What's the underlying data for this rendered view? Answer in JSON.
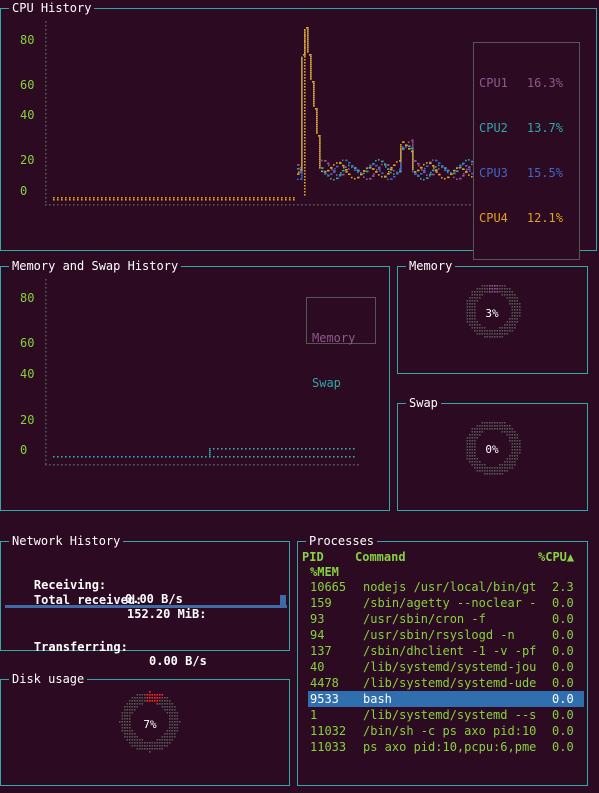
{
  "cpu": {
    "title": "CPU History",
    "yticks": [
      "80",
      "60",
      "40",
      "20",
      "0"
    ],
    "legend": [
      {
        "name": "CPU1",
        "value": "16.3%",
        "color": "#8e5a8e"
      },
      {
        "name": "CPU2",
        "value": "13.7%",
        "color": "#2ea8a8"
      },
      {
        "name": "CPU3",
        "value": "15.5%",
        "color": "#3f66c4"
      },
      {
        "name": "CPU4",
        "value": "12.1%",
        "color": "#e0a020"
      }
    ]
  },
  "memory_history": {
    "title": "Memory and Swap History",
    "yticks": [
      "80",
      "60",
      "40",
      "20",
      "0"
    ],
    "legend": [
      {
        "name": "Memory",
        "color": "#8e5a8e"
      },
      {
        "name": "Swap",
        "color": "#2ea8a8"
      }
    ]
  },
  "memory": {
    "title": "Memory",
    "value": "3%"
  },
  "swap": {
    "title": "Swap",
    "value": "0%"
  },
  "network": {
    "title": "Network History",
    "receiving_label": "Receiving:",
    "receiving_value": "0.00 B/s",
    "total_label": "Total received:",
    "total_value": "152.20 MiB:",
    "transferring_label": "Transferring:",
    "transferring_value": "0.00 B/s"
  },
  "disk": {
    "title": "Disk usage",
    "value": "7%"
  },
  "processes": {
    "title": "Processes",
    "headers": {
      "pid": "PID",
      "command": "Command",
      "cpu": "%CPU▲",
      "mem": "%MEM"
    },
    "rows": [
      {
        "pid": "10665",
        "command": "nodejs /usr/local/bin/gt",
        "cpu": "2.3"
      },
      {
        "pid": "159",
        "command": "/sbin/agetty --noclear -",
        "cpu": "0.0"
      },
      {
        "pid": "93",
        "command": "/usr/sbin/cron -f",
        "cpu": "0.0"
      },
      {
        "pid": "94",
        "command": "/usr/sbin/rsyslogd -n",
        "cpu": "0.0"
      },
      {
        "pid": "137",
        "command": "/sbin/dhclient -1 -v -pf",
        "cpu": "0.0"
      },
      {
        "pid": "40",
        "command": "/lib/systemd/systemd-jou",
        "cpu": "0.0"
      },
      {
        "pid": "4478",
        "command": "/lib/systemd/systemd-ude",
        "cpu": "0.0"
      },
      {
        "pid": "9533",
        "command": "bash",
        "cpu": "0.0",
        "selected": true
      },
      {
        "pid": "1",
        "command": "/lib/systemd/systemd --s",
        "cpu": "0.0"
      },
      {
        "pid": "11032",
        "command": "/bin/sh -c ps axo pid:10",
        "cpu": "0.0"
      },
      {
        "pid": "11033",
        "command": "ps axo pid:10,pcpu:6,pme",
        "cpu": "0.0"
      }
    ]
  }
}
